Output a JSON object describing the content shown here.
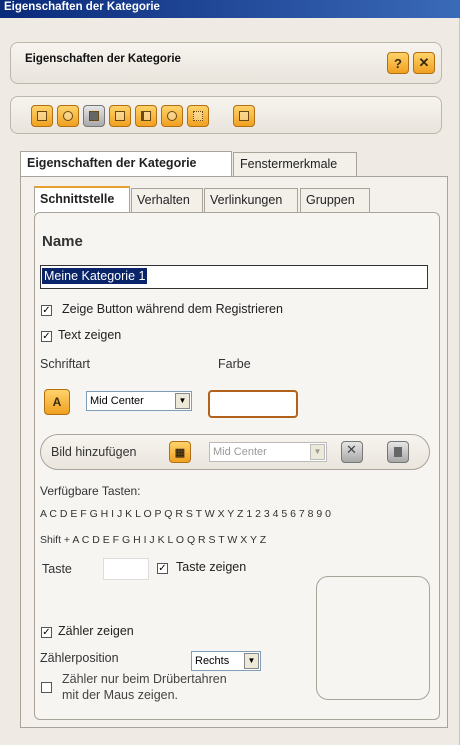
{
  "window": {
    "title": "Eigenschaften der Kategorie"
  },
  "header": {
    "title": "Eigenschaften der Kategorie",
    "help_label": "?",
    "close_label": "✕"
  },
  "toolbar": {
    "icons": [
      "add-icon",
      "shape-icon",
      "stop-icon",
      "hand-icon",
      "list-icon",
      "picture-icon",
      "grid-icon",
      "copy-icon"
    ]
  },
  "outer_tabs": [
    "Eigenschaften der Kategorie",
    "Fenstermerkmale"
  ],
  "inner_tabs": [
    "Schnittstelle",
    "Verhalten",
    "Verlinkungen",
    "Gruppen"
  ],
  "form": {
    "section_title": "Name",
    "name_value": "Meine Kategorie 1",
    "show_button_label": "Zeige Button während dem Registrieren",
    "show_text_label": "Text zeigen",
    "font_label": "Schriftart",
    "color_label": "Farbe",
    "font_align_value": "Mid Center",
    "add_image_label": "Bild hinzufügen",
    "image_align_value": "Mid Center",
    "keys_label": "Verfügbare Tasten:",
    "keys_list": "A C D E F G H I J K L O P Q R S T W X Y Z 1 2 3 4 5 6 7 8 9 0",
    "shift_keys_list": "Shift + A C D E F G H I J K L O Q R S T W X Y Z",
    "key_label": "Taste",
    "show_key_label": "Taste zeigen",
    "show_counter_label": "Zähler zeigen",
    "counter_position_label": "Zählerposition",
    "counter_position_value": "Rechts",
    "counter_hover_label_1": "Zähler nur beim Drübertahren",
    "counter_hover_label_2": "mit der Maus zeigen."
  },
  "checks": {
    "checked": "☑",
    "mark": "✓"
  }
}
